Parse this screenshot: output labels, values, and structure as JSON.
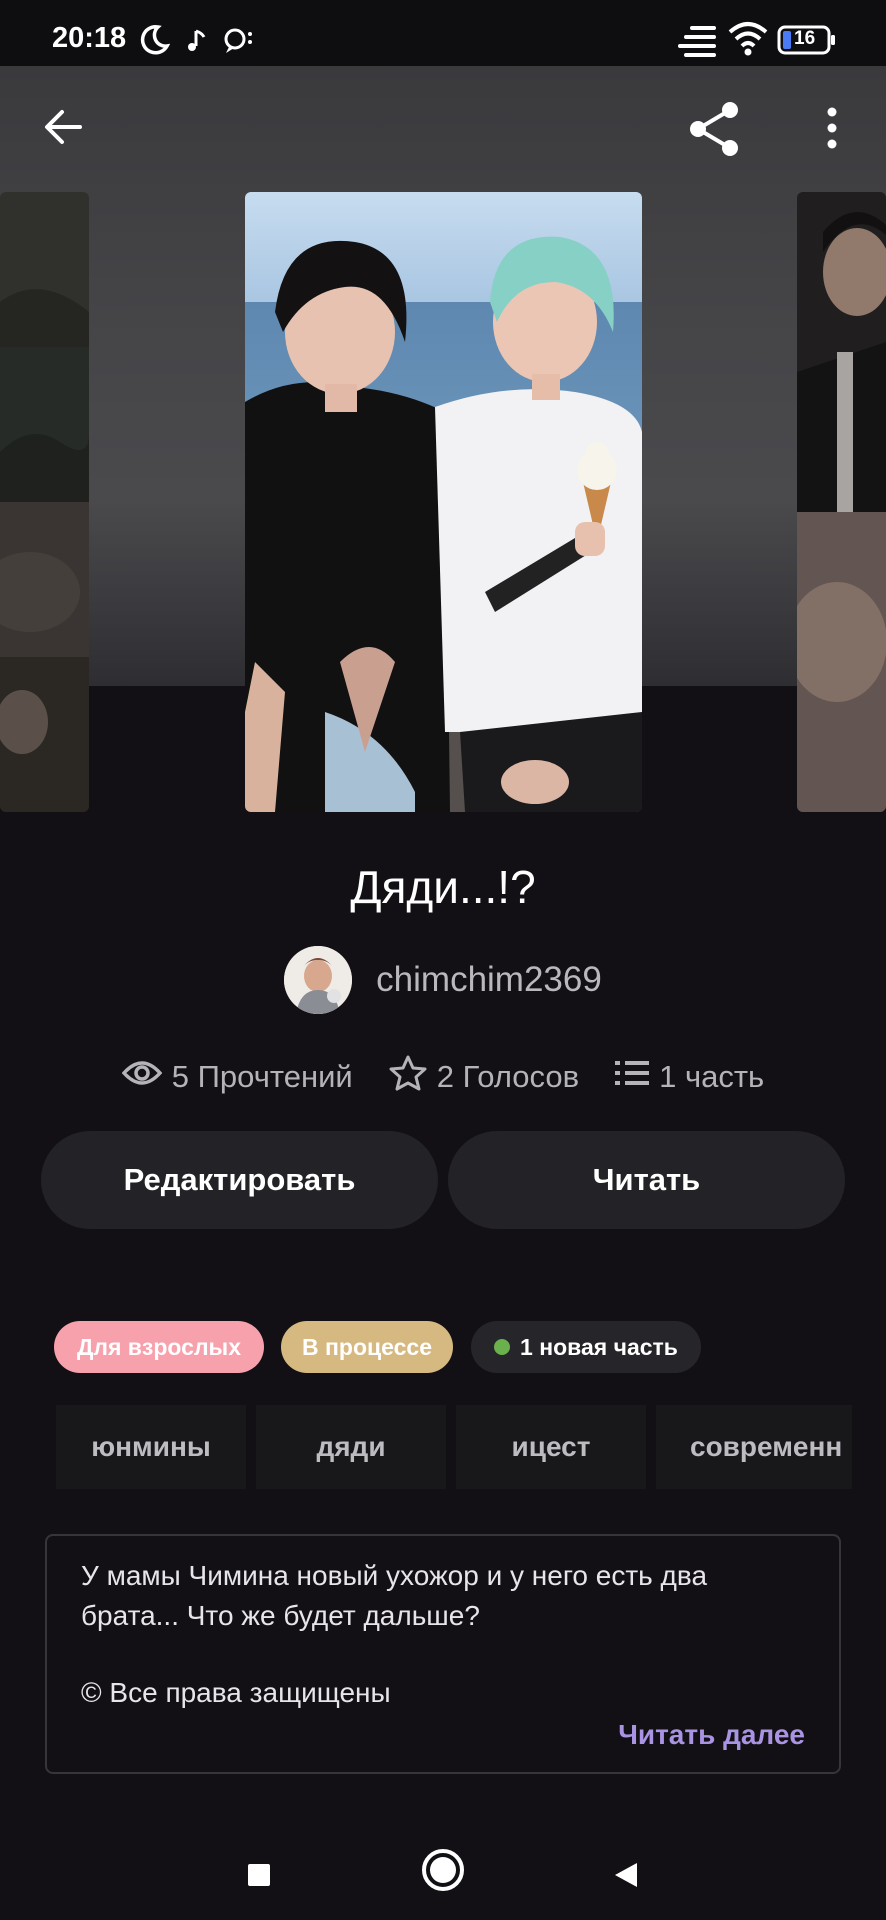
{
  "status_bar": {
    "time": "20:18",
    "battery": "16",
    "icons": [
      "moon-icon",
      "music-note-icon",
      "chat-bubble-icon",
      "data-lines-icon",
      "wifi-icon",
      "battery-icon"
    ]
  },
  "header": {
    "icons": [
      "back-arrow-icon",
      "share-icon",
      "more-vert-icon"
    ]
  },
  "story": {
    "title": "Дяди...!?",
    "author": "chimchim2369",
    "stats": {
      "reads": "5 Прочтений",
      "votes": "2 Голосов",
      "parts": "1 часть"
    }
  },
  "actions": {
    "edit_label": "Редактировать",
    "read_label": "Читать"
  },
  "badges": {
    "adult": "Для взрослых",
    "in_progress": "В процессе",
    "new_part": "1 новая часть"
  },
  "tags": [
    "юнмины",
    "дяди",
    "ицест",
    "современн"
  ],
  "description": {
    "text": "У мамы Чимина новый ухожор и у него есть два брата... Что же будет дальше?",
    "copyright": "© Все права защищены",
    "read_more": "Читать далее"
  },
  "colors": {
    "badge_adult": "#f7a1ad",
    "badge_in_progress": "#d6b981",
    "badge_new_part_bg": "#26252a",
    "new_dot": "#6ab04c",
    "read_more": "#a993e3"
  }
}
